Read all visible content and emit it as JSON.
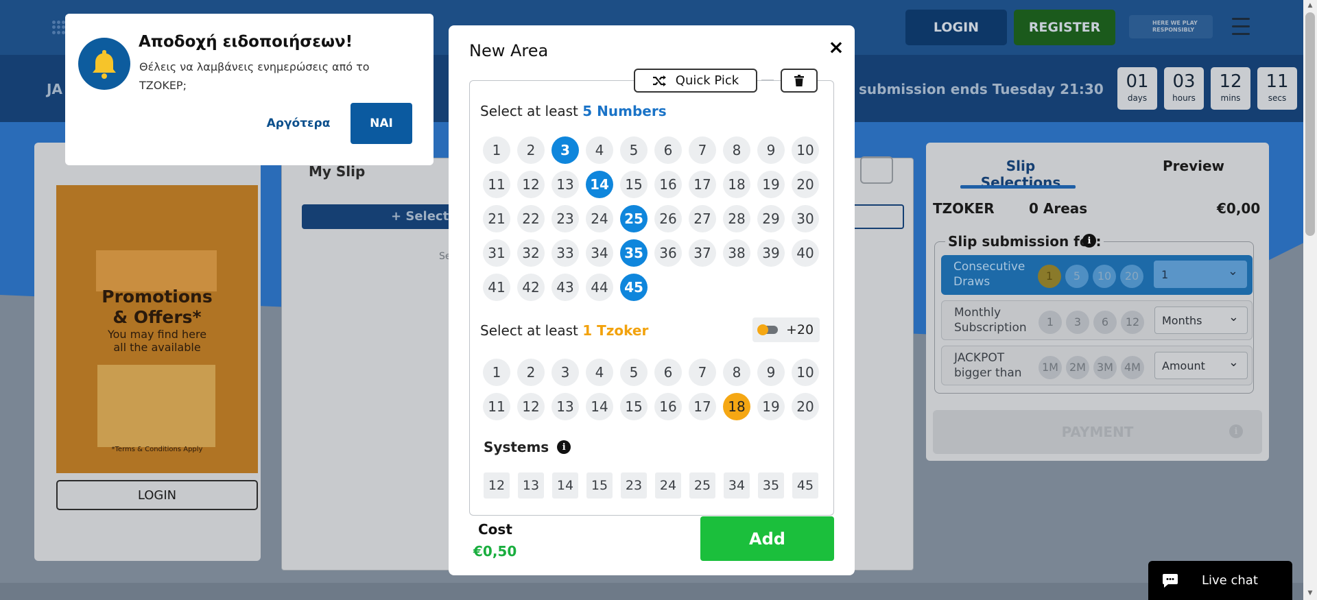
{
  "header": {
    "login_label": "LOGIN",
    "register_label": "REGISTER",
    "responsible_badge": "HERE WE PLAY RESPONSIBLY",
    "jackpot_prefix": "JA",
    "submission_text": "submission ends Tuesday 21:30",
    "countdown": [
      {
        "value": "01",
        "unit": "days"
      },
      {
        "value": "03",
        "unit": "hours"
      },
      {
        "value": "12",
        "unit": "mins"
      },
      {
        "value": "11",
        "unit": "secs"
      }
    ]
  },
  "promo": {
    "title_line1": "Promotions",
    "title_line2": "& Offers*",
    "text_line1": "You may find here",
    "text_line2": "all the available",
    "terms": "*Terms & Conditions Apply",
    "login_label": "LOGIN"
  },
  "my_slip": {
    "title": "My Slip",
    "select_label": "+ Select",
    "placeholder_fragment": "Se"
  },
  "right_panel": {
    "tab_selections": "Slip Selections",
    "tab_preview": "Preview",
    "game": "TZOKER",
    "areas": "0 Areas",
    "total": "€0,00",
    "submission_title": "Slip submission for:",
    "options": [
      {
        "label_line1": "Consecutive",
        "label_line2": "Draws",
        "pills": [
          "1",
          "5",
          "10",
          "20"
        ],
        "select_value": "1"
      },
      {
        "label_line1": "Monthly",
        "label_line2": "Subscription",
        "pills": [
          "1",
          "3",
          "6",
          "12"
        ],
        "select_value": "Months"
      },
      {
        "label_line1": "JACKPOT",
        "label_line2": "bigger than",
        "pills": [
          "1M",
          "2M",
          "3M",
          "4M"
        ],
        "select_value": "Amount"
      }
    ],
    "payment_label": "PAYMENT"
  },
  "notification": {
    "title": "Αποδοχή ειδοποιήσεων!",
    "body": "Θέλεις να λαμβάνεις ενημερώσεις από το ΤΖΟΚΕΡ;",
    "later_label": "Αργότερα",
    "yes_label": "ΝΑΙ"
  },
  "modal": {
    "title": "New Area",
    "quick_pick_label": "Quick Pick",
    "numbers_prompt_prefix": "Select at least",
    "numbers_prompt_highlight": "5 Numbers",
    "numbers": [
      "1",
      "2",
      "3",
      "4",
      "5",
      "6",
      "7",
      "8",
      "9",
      "10",
      "11",
      "12",
      "13",
      "14",
      "15",
      "16",
      "17",
      "18",
      "19",
      "20",
      "21",
      "22",
      "23",
      "24",
      "25",
      "26",
      "27",
      "28",
      "29",
      "30",
      "31",
      "32",
      "33",
      "34",
      "35",
      "36",
      "37",
      "38",
      "39",
      "40",
      "41",
      "42",
      "43",
      "44",
      "45"
    ],
    "selected_numbers": [
      "3",
      "14",
      "25",
      "35",
      "45"
    ],
    "tzoker_prompt_prefix": "Select at least",
    "tzoker_prompt_highlight": "1 Tzoker",
    "plus_label": "+20",
    "tzoker_numbers": [
      "1",
      "2",
      "3",
      "4",
      "5",
      "6",
      "7",
      "8",
      "9",
      "10",
      "11",
      "12",
      "13",
      "14",
      "15",
      "16",
      "17",
      "18",
      "19",
      "20"
    ],
    "selected_tzoker": [
      "18"
    ],
    "systems_label": "Systems",
    "systems": [
      "12",
      "13",
      "14",
      "15",
      "23",
      "24",
      "25",
      "34",
      "35",
      "45"
    ],
    "cost_label": "Cost",
    "cost_value": "€0,50",
    "add_label": "Add"
  },
  "live_chat": {
    "label": "Live chat"
  },
  "colors": {
    "accent_blue": "#0f86dc",
    "tzoker_orange": "#f5a713",
    "add_green": "#1bbf3c",
    "cost_green": "#1aae3f",
    "notif_blue": "#0b5aa0"
  }
}
